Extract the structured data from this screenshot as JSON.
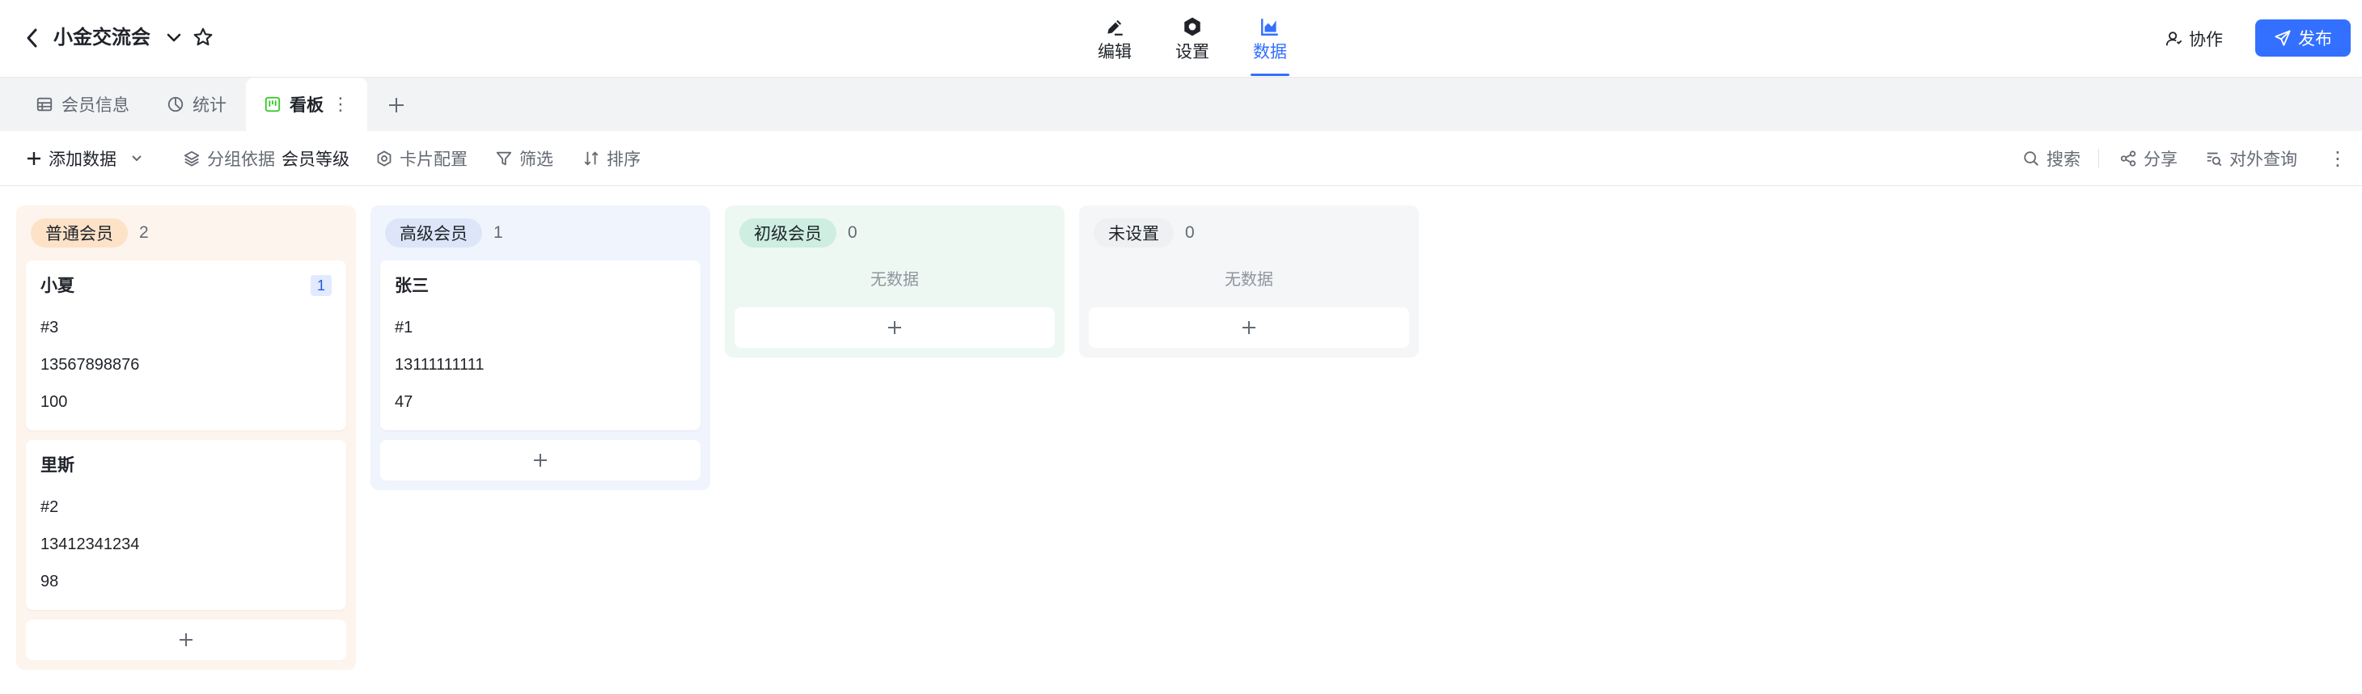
{
  "header": {
    "back_icon": "chevron-left-icon",
    "title": "小金交流会",
    "title_chevron_icon": "chevron-down-icon",
    "star_icon": "star-icon",
    "modes": [
      {
        "label": "编辑",
        "icon": "pencil-icon",
        "active": false
      },
      {
        "label": "设置",
        "icon": "gear-icon",
        "active": false
      },
      {
        "label": "数据",
        "icon": "chart-icon",
        "active": true
      }
    ],
    "collaborate_label": "协作",
    "publish_label": "发布",
    "accent_color": "#3370ff"
  },
  "view_tabs": [
    {
      "label": "会员信息",
      "icon": "table-icon",
      "active": false
    },
    {
      "label": "统计",
      "icon": "pie-chart-icon",
      "active": false
    },
    {
      "label": "看板",
      "icon": "kanban-icon",
      "active": true
    }
  ],
  "toolbar": {
    "add_data_label": "添加数据",
    "group_by_label": "分组依据",
    "group_by_value": "会员等级",
    "card_config_label": "卡片配置",
    "filter_label": "筛选",
    "sort_label": "排序",
    "search_label": "搜索",
    "share_label": "分享",
    "external_query_label": "对外查询"
  },
  "board": {
    "empty_text": "无数据",
    "add_icon": "plus-icon",
    "columns": [
      {
        "name": "普通会员",
        "count": "2",
        "bg": "#fdf4ed",
        "pill_bg": "#fde2c8",
        "cards": [
          {
            "title": "小夏",
            "badge": "1",
            "lines": [
              "#3",
              "13567898876",
              "100"
            ]
          },
          {
            "title": "里斯",
            "badge": "",
            "lines": [
              "#2",
              "13412341234",
              "98"
            ]
          }
        ]
      },
      {
        "name": "高级会员",
        "count": "1",
        "bg": "#f0f4fc",
        "pill_bg": "#dce6f8",
        "cards": [
          {
            "title": "张三",
            "badge": "",
            "lines": [
              "#1",
              "13111111111",
              "47"
            ]
          }
        ]
      },
      {
        "name": "初级会员",
        "count": "0",
        "bg": "#eef8f3",
        "pill_bg": "#cdeee0",
        "cards": []
      },
      {
        "name": "未设置",
        "count": "0",
        "bg": "#f5f6f7",
        "pill_bg": "#eff0f1",
        "cards": []
      }
    ]
  }
}
